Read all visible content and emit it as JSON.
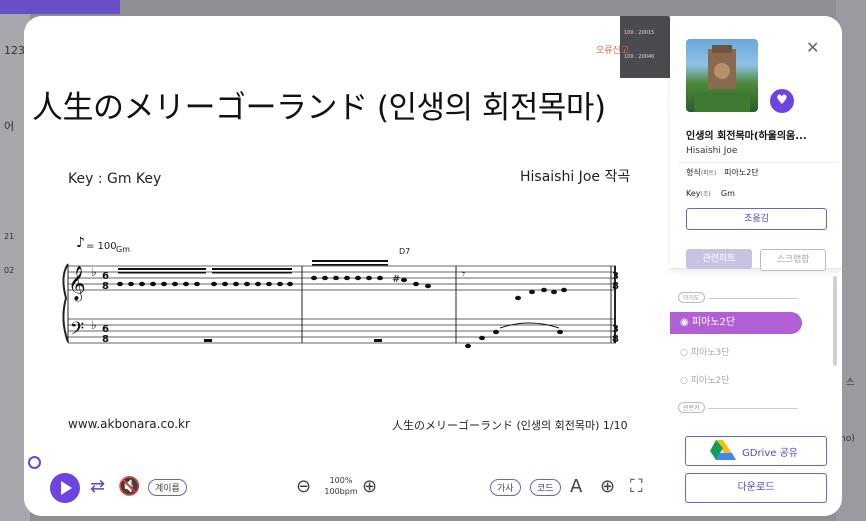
{
  "background": {
    "left_snippets": [
      "123",
      "어",
      "21",
      "02"
    ],
    "right_snippets": [
      "스",
      "no)"
    ]
  },
  "score": {
    "report_label": "오류신고",
    "title": "人生のメリーゴーランド (인생의 회전목마)",
    "key": "Key : Gm Key",
    "composer": "Hisaishi Joe 작곡",
    "tempo": "= 100",
    "chord_gm": "Gm",
    "chord_d7": "D7",
    "site": "www.akbonara.co.kr",
    "page_footer": "人生のメリーゴーランド (인생의 회전목마) 1/10"
  },
  "controls": {
    "scale_label": "계이름",
    "zoom_percent": "100%",
    "bpm": "100bpm",
    "lyrics_label": "가사",
    "chord_label": "코드",
    "accent": "#6c45e0"
  },
  "panel": {
    "title": "인생의 회전목마(하울의움...",
    "artist": "Hisaishi Joe",
    "format_label": "형식",
    "format_small": "(파트)",
    "format_value": "피아노2단",
    "key_label": "Key",
    "key_small": "(조)",
    "key_value": "Gm",
    "transpose_label": "조옮김",
    "related_label": "관련피트",
    "scrap_label": "스크랩함",
    "section_difficulty": "악기도",
    "section_related": "관련키",
    "options": [
      "피아노2단",
      "피아노3단",
      "피아노2단"
    ],
    "gdrive_label": "GDrive 공유",
    "download_label": "다운로드"
  }
}
